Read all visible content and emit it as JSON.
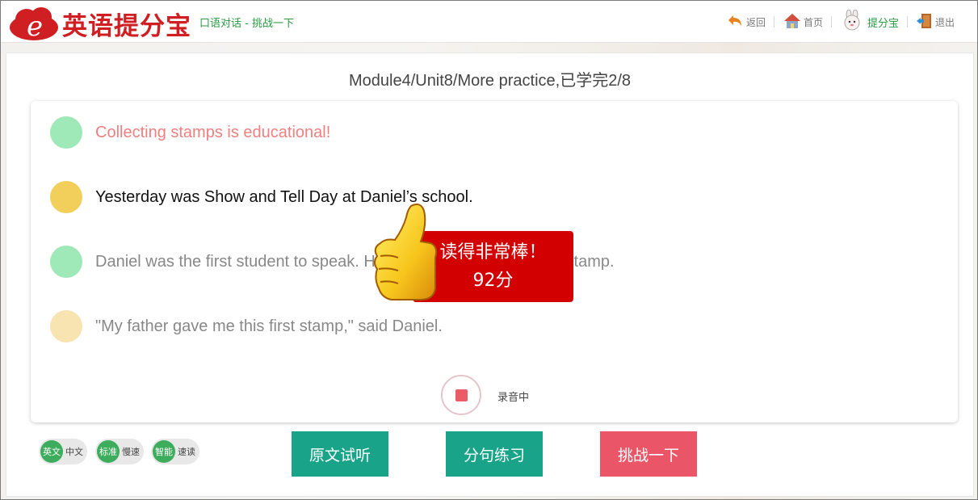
{
  "header": {
    "logo_letter": "e",
    "app_name": "英语提分宝",
    "subtitle": "口语对话 - 挑战一下",
    "nav": {
      "back": "返回",
      "home": "首页",
      "tifenbao": "提分宝",
      "logout": "退出"
    }
  },
  "progress_title": "Module4/Unit8/More practice,已学完2/8",
  "sentences": [
    {
      "text": "Collecting stamps is educational!",
      "dot_color": "#9fe8b8",
      "text_color": "#f07f7f"
    },
    {
      "text": "Yesterday was Show and Tell Day at Daniel’s school.",
      "dot_color": "#f2cf5a",
      "text_color": "#111111"
    },
    {
      "text": "Daniel was the first student to speak. He showed the class an old stamp.",
      "dot_color": "#9fe8b8",
      "text_color": "#888888"
    },
    {
      "text": "\"My father gave me this first stamp,\" said Daniel.",
      "dot_color": "#f8e4b0",
      "text_color": "#888888"
    }
  ],
  "recording": {
    "label": "录音中"
  },
  "praise": {
    "line1": "读得非常棒！",
    "line2": "92分"
  },
  "toggles": [
    {
      "on": "英文",
      "off": "中文"
    },
    {
      "on": "标准",
      "off": "慢速"
    },
    {
      "on": "智能",
      "off": "速读"
    }
  ],
  "buttons": {
    "listen": "原文试听",
    "practice": "分句练习",
    "challenge": "挑战一下"
  },
  "colors": {
    "brand_red": "#d01f23",
    "teal": "#19a48a",
    "challenge_red": "#ea5667",
    "praise_red": "#d20000"
  }
}
